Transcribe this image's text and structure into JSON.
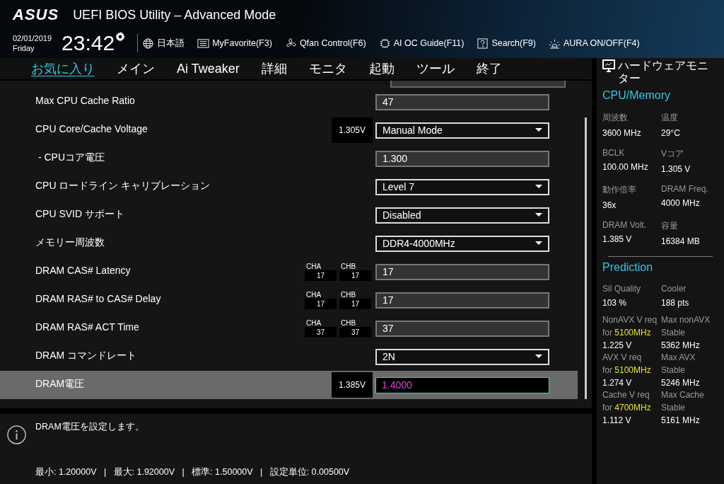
{
  "header": {
    "logo": "ASUS",
    "title": "UEFI BIOS Utility – Advanced Mode",
    "date": "02/01/2019",
    "day": "Friday",
    "time": "23:42",
    "toolbar": [
      {
        "kind": "globe",
        "label": "日本語"
      },
      {
        "kind": "favorite",
        "label": "MyFavorite(F3)"
      },
      {
        "kind": "fan",
        "label": "Qfan Control(F6)"
      },
      {
        "kind": "chip",
        "label": "AI OC Guide(F11)"
      },
      {
        "kind": "help",
        "label": "Search(F9)"
      },
      {
        "kind": "light",
        "label": "AURA ON/OFF(F4)"
      }
    ]
  },
  "tabs": [
    {
      "label": "お気に入り",
      "selected": true
    },
    {
      "label": "メイン",
      "selected": false
    },
    {
      "label": "Ai Tweaker",
      "selected": false
    },
    {
      "label": "詳細",
      "selected": false
    },
    {
      "label": "モニタ",
      "selected": false
    },
    {
      "label": "起動",
      "selected": false
    },
    {
      "label": "ツール",
      "selected": false
    },
    {
      "label": "終了",
      "selected": false
    }
  ],
  "settings": [
    {
      "label": "Max CPU Cache Ratio",
      "kind": "field",
      "value": "47",
      "selected": false
    },
    {
      "label": "CPU Core/Cache Voltage",
      "kind": "dropdown",
      "value": "Manual Mode",
      "reading": "1.305V",
      "selected": false
    },
    {
      "label": " - CPUコア電圧",
      "kind": "field",
      "value": "1.300",
      "selected": false
    },
    {
      "label": "CPU ロードライン キャリブレーション",
      "kind": "dropdown",
      "value": "Level 7",
      "selected": false
    },
    {
      "label": "CPU SVID サポート",
      "kind": "dropdown",
      "value": "Disabled",
      "selected": false
    },
    {
      "label": "メモリー周波数",
      "kind": "dropdown",
      "value": "DDR4-4000MHz",
      "selected": false
    },
    {
      "label": "DRAM CAS# Latency",
      "kind": "field",
      "value": "17",
      "selected": false,
      "channels": [
        {
          "name": "CHA",
          "value": "17"
        },
        {
          "name": "CHB",
          "value": "17"
        }
      ]
    },
    {
      "label": "DRAM RAS# to CAS# Delay",
      "kind": "field",
      "value": "17",
      "selected": false,
      "channels": [
        {
          "name": "CHA",
          "value": "17"
        },
        {
          "name": "CHB",
          "value": "17"
        }
      ]
    },
    {
      "label": "DRAM RAS# ACT Time",
      "kind": "field",
      "value": "37",
      "selected": false,
      "channels": [
        {
          "name": "CHA",
          "value": "37"
        },
        {
          "name": "CHB",
          "value": "37"
        }
      ]
    },
    {
      "label": "DRAM コマンドレート",
      "kind": "dropdown",
      "value": "2N",
      "selected": false
    },
    {
      "label": "DRAM電圧",
      "kind": "field",
      "value": "1.4000",
      "reading": "1.385V",
      "selected": true
    }
  ],
  "help": {
    "description": "DRAM電圧を設定します。",
    "limits": "最小: 1.20000V   |   最大: 1.92000V   |   標準: 1.50000V   |   設定単位: 0.00500V"
  },
  "monitor": {
    "title": "ハードウェアモニター",
    "cpu_memory": {
      "title": "CPU/Memory",
      "stats": [
        {
          "label": "周波数",
          "value": "3600 MHz"
        },
        {
          "label": "温度",
          "value": "29°C"
        },
        {
          "label": "BCLK",
          "value": "100.00 MHz"
        },
        {
          "label": "Vコア",
          "value": "1.305 V"
        },
        {
          "label": "動作倍率",
          "value": "36x"
        },
        {
          "label": "DRAM Freq.",
          "value": "4000 MHz"
        },
        {
          "label": "DRAM Volt.",
          "value": "1.385 V"
        },
        {
          "label": "容量",
          "value": "16384 MB"
        }
      ]
    },
    "prediction": {
      "title": "Prediction",
      "stats": [
        {
          "label": "Sil Quality",
          "value": "103 %"
        },
        {
          "label": "Cooler",
          "value": "188 pts"
        }
      ],
      "requirements": [
        {
          "label": "NonAVX V req",
          "prefix": "for",
          "frequency": "5100MHz",
          "value": "1.225 V",
          "max_label": "Max nonAVX",
          "max_sub": "Stable",
          "max_value": "5362 MHz"
        },
        {
          "label": "AVX V req",
          "prefix": "for",
          "frequency": "5100MHz",
          "value": "1.274 V",
          "max_label": "Max AVX",
          "max_sub": "Stable",
          "max_value": "5246 MHz"
        },
        {
          "label": "Cache V req",
          "prefix": "for",
          "frequency": "4700MHz",
          "value": "1.112 V",
          "max_label": "Max Cache",
          "max_sub": "Stable",
          "max_value": "5161 MHz"
        }
      ]
    }
  }
}
